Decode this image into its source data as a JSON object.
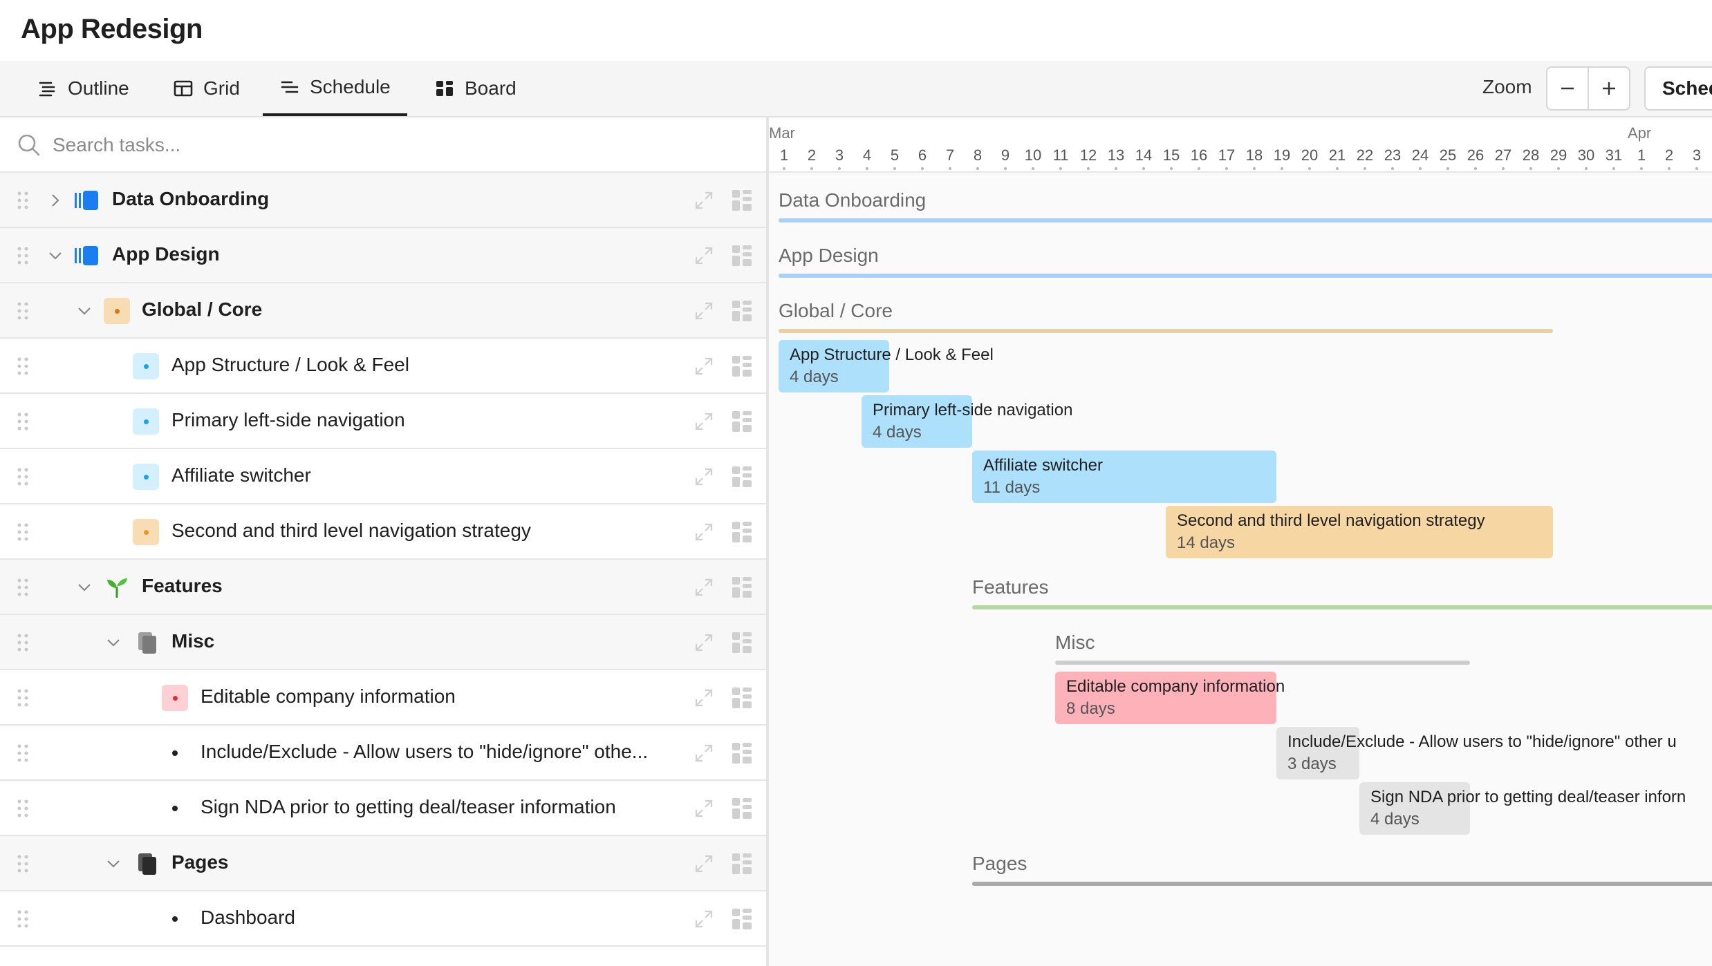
{
  "app_title": "App Redesign",
  "tabs": [
    {
      "label": "Outline",
      "icon": "outline-icon"
    },
    {
      "label": "Grid",
      "icon": "grid-icon"
    },
    {
      "label": "Schedule",
      "icon": "schedule-icon",
      "active": true
    },
    {
      "label": "Board",
      "icon": "board-icon"
    }
  ],
  "zoom": {
    "label": "Zoom",
    "minus_icon": "minus-icon",
    "plus_icon": "plus-icon"
  },
  "schedule_button": {
    "label": "Sched"
  },
  "search": {
    "placeholder": "Search tasks..."
  },
  "rows": [
    {
      "label": "Data Onboarding",
      "type": "project",
      "expanded": false
    },
    {
      "label": "App Design",
      "type": "project",
      "expanded": true
    },
    {
      "label": "Global / Core",
      "type": "section",
      "expanded": true
    },
    {
      "label": "App Structure / Look & Feel",
      "type": "task"
    },
    {
      "label": "Primary left-side navigation",
      "type": "task"
    },
    {
      "label": "Affiliate switcher",
      "type": "task"
    },
    {
      "label": "Second and third level navigation strategy",
      "type": "task"
    },
    {
      "label": "Features",
      "type": "section",
      "expanded": true
    },
    {
      "label": "Misc",
      "type": "section",
      "expanded": true
    },
    {
      "label": "Editable company information",
      "type": "task"
    },
    {
      "label": "Include/Exclude - Allow users to \"hide/ignore\" othe...",
      "type": "task"
    },
    {
      "label": "Sign NDA prior to getting deal/teaser information",
      "type": "task"
    },
    {
      "label": "Pages",
      "type": "section",
      "expanded": true
    },
    {
      "label": "Dashboard",
      "type": "task"
    }
  ],
  "timeline": {
    "months": [
      "Mar",
      "Apr"
    ],
    "days": [
      "1",
      "2",
      "3",
      "4",
      "5",
      "6",
      "7",
      "8",
      "9",
      "10",
      "11",
      "12",
      "13",
      "14",
      "15",
      "16",
      "17",
      "18",
      "19",
      "20",
      "21",
      "22",
      "23",
      "24",
      "25",
      "26",
      "27",
      "28",
      "29",
      "30",
      "31",
      "1",
      "2",
      "3"
    ]
  },
  "gantt_groups": [
    {
      "label": "Data Onboarding"
    },
    {
      "label": "App Design"
    },
    {
      "label": "Global / Core"
    },
    {
      "label": "Features"
    },
    {
      "label": "Misc"
    },
    {
      "label": "Pages"
    }
  ],
  "gantt_tasks": [
    {
      "name": "App Structure / Look & Feel",
      "duration": "4 days",
      "start": "Mar 1",
      "days": 4
    },
    {
      "name": "Primary left-side navigation",
      "duration": "4 days",
      "start": "Mar 4",
      "days": 4
    },
    {
      "name": "Affiliate switcher",
      "duration": "11 days",
      "start": "Mar 8",
      "days": 11
    },
    {
      "name": "Second and third level navigation strategy",
      "duration": "14 days",
      "start": "Mar 15",
      "days": 14
    },
    {
      "name": "Editable company information",
      "duration": "8 days",
      "start": "Mar 11",
      "days": 8
    },
    {
      "name": "Include/Exclude - Allow users to \"hide/ignore\" other u",
      "duration": "3 days",
      "start": "Mar 19",
      "days": 3
    },
    {
      "name": "Sign NDA prior to getting deal/teaser inforn",
      "duration": "4 days",
      "start": "Mar 22",
      "days": 4
    }
  ],
  "colors": {
    "project_blue": "#1a7df0",
    "bar_blue": "#a9d6f8",
    "task_blue": "#ade0fb",
    "task_orange": "#f6d6a3",
    "bar_orange": "#e8cfa6",
    "task_pink": "#fdb1b8",
    "task_gray": "#e4e4e4",
    "bar_green": "#b6d7a0",
    "bar_gray": "#cccccc"
  }
}
